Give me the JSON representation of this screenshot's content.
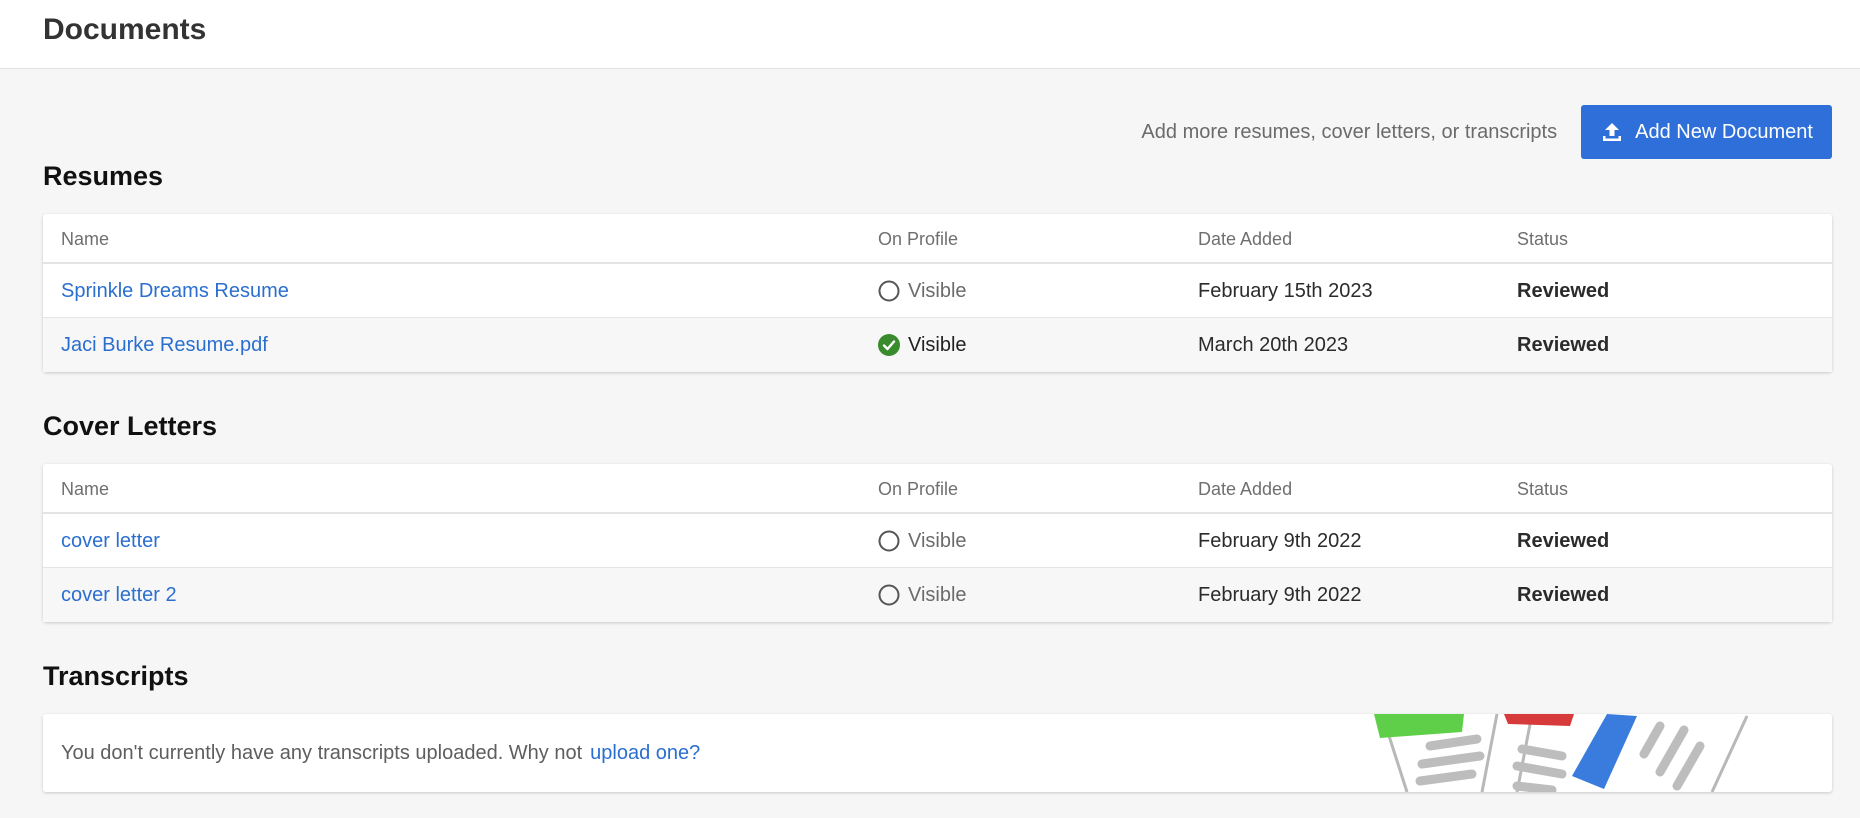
{
  "header": {
    "title": "Documents"
  },
  "actions": {
    "hint": "Add more resumes, cover letters, or transcripts",
    "add_button_label": "Add New Document"
  },
  "columns": {
    "name": "Name",
    "on_profile": "On Profile",
    "date_added": "Date Added",
    "status": "Status"
  },
  "resumes": {
    "title": "Resumes",
    "rows": [
      {
        "name": "Sprinkle Dreams Resume",
        "visibility": "Visible",
        "visible_on_profile": false,
        "date": "February 15th 2023",
        "status": "Reviewed"
      },
      {
        "name": "Jaci Burke Resume.pdf",
        "visibility": "Visible",
        "visible_on_profile": true,
        "date": "March 20th 2023",
        "status": "Reviewed"
      }
    ]
  },
  "cover_letters": {
    "title": "Cover Letters",
    "rows": [
      {
        "name": "cover letter",
        "visibility": "Visible",
        "visible_on_profile": false,
        "date": "February 9th 2022",
        "status": "Reviewed"
      },
      {
        "name": "cover letter 2",
        "visibility": "Visible",
        "visible_on_profile": false,
        "date": "February 9th 2022",
        "status": "Reviewed"
      }
    ]
  },
  "transcripts": {
    "title": "Transcripts",
    "empty_text": "You don't currently have any transcripts uploaded. Why not",
    "upload_link": "upload one?"
  },
  "colors": {
    "accent": "#2e6fd9",
    "link": "#2a6fcf",
    "check_green": "#3a8a2e"
  },
  "icons": {
    "add": "upload-icon",
    "not_visible": "circle-icon",
    "visible": "check-circle-icon"
  }
}
